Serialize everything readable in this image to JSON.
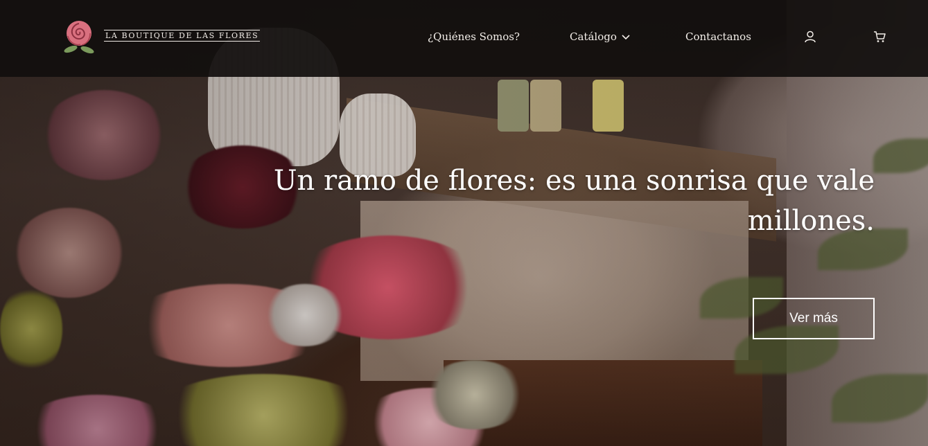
{
  "brand": {
    "name": "LA BOUTIQUE DE LAS FLORES",
    "logo_icon": "rose-icon"
  },
  "nav": {
    "items": [
      {
        "label": "¿Quiénes Somos?"
      },
      {
        "label": "Catálogo",
        "icon": "chevron-down-icon"
      },
      {
        "label": "Contactanos"
      }
    ],
    "icons": [
      "user-icon",
      "cart-icon"
    ]
  },
  "hero": {
    "headline": "Un ramo de flores: es una sonrisa que vale millones.",
    "cta_label": "Ver más"
  },
  "colors": {
    "header_bg": "#120f0e",
    "text": "#ffffff",
    "rose": "#d9707f"
  }
}
